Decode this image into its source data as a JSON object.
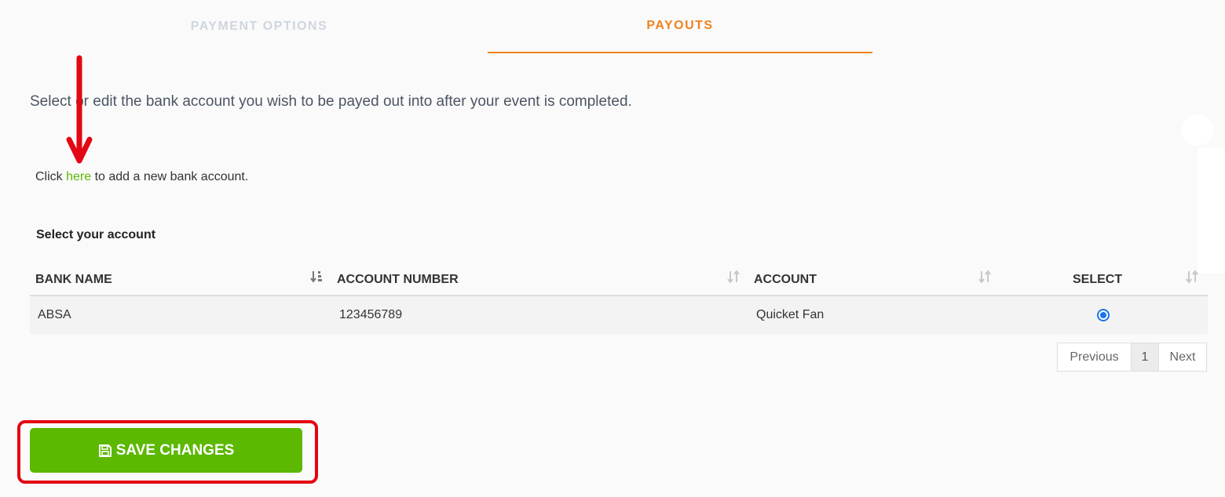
{
  "tabs": [
    {
      "label": "PAYMENT OPTIONS",
      "active": false
    },
    {
      "label": "PAYOUTS",
      "active": true
    }
  ],
  "intro_text": "Select or edit the bank account you wish to be payed out into after your event is completed.",
  "add_account": {
    "prefix": "Click ",
    "link": "here",
    "suffix": " to add a new bank account."
  },
  "select_title": "Select your account",
  "table": {
    "headers": [
      "BANK NAME",
      "ACCOUNT NUMBER",
      "ACCOUNT",
      "SELECT"
    ],
    "rows": [
      {
        "bank": "ABSA",
        "number": "123456789",
        "account": "Quicket Fan",
        "selected": true
      }
    ]
  },
  "pagination": {
    "previous": "Previous",
    "page": "1",
    "next": "Next"
  },
  "save_button": {
    "label": "SAVE CHANGES",
    "icon": "floppy-disk-icon"
  },
  "colors": {
    "accent_orange": "#f0821e",
    "green": "#5cb800",
    "annotation_red": "#e30613",
    "radio_blue": "#1a73e8"
  }
}
